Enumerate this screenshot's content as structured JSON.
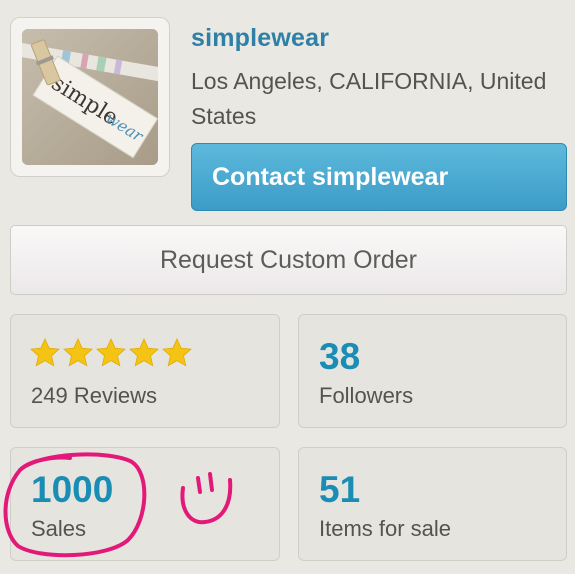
{
  "shop": {
    "name": "simplewear",
    "location": "Los Angeles, CALIFORNIA, United States",
    "logo_text_1": "simple",
    "logo_text_2": "wear"
  },
  "actions": {
    "contact_label": "Contact simplewear",
    "custom_order_label": "Request Custom Order"
  },
  "stats": {
    "reviews": {
      "rating": 5,
      "max_rating": 5,
      "label": "249 Reviews"
    },
    "followers": {
      "value": "38",
      "label": "Followers"
    },
    "sales": {
      "value": "1000",
      "label": "Sales"
    },
    "items": {
      "value": "51",
      "label": "Items for sale"
    }
  },
  "colors": {
    "accent": "#2f7fa6",
    "number": "#1a8db4",
    "star": "#f4c414",
    "annotation": "#e3197a"
  }
}
